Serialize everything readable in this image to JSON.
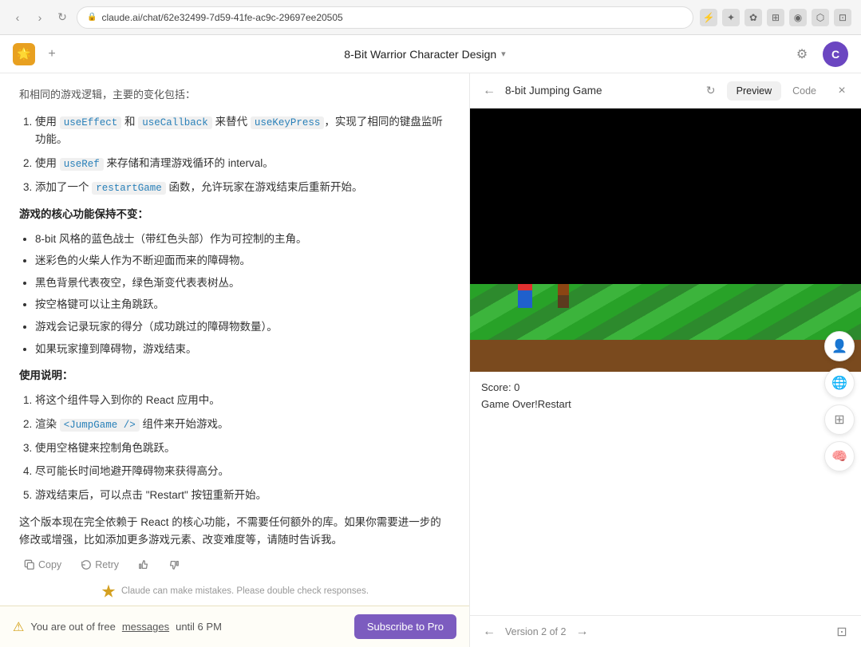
{
  "browser": {
    "url": "claude.ai/chat/62e32499-7d59-41fe-ac9c-29697ee20505",
    "back_disabled": false,
    "forward_disabled": false
  },
  "header": {
    "logo_emoji": "🌟",
    "new_chat_icon": "+",
    "title": "8-Bit Warrior Character Design",
    "chevron": "▾",
    "settings_icon": "⚙",
    "user_initial": "C"
  },
  "chat": {
    "intro_text": "和相同的游戏逻辑，主要的变化包括：",
    "steps": [
      {
        "id": 1,
        "text_parts": [
          "使用 ",
          "useEffect",
          " 和 ",
          "useCallback",
          " 来替代 ",
          "useKeyPress",
          "，实现了相同的键盘监听功能。"
        ]
      },
      {
        "id": 2,
        "text_parts": [
          "使用 ",
          "useRef",
          " 来存储和清理游戏循环的 interval。"
        ]
      },
      {
        "id": 3,
        "text_parts": [
          "添加了一个 ",
          "restartGame",
          " 函数，允许玩家在游戏结束后重新开始。"
        ]
      }
    ],
    "features_title": "游戏的核心功能保持不变：",
    "features": [
      "8-bit 风格的蓝色战士（带红色头部）作为可控制的主角。",
      "迷彩色的火柴人作为不断迎面而来的障碍物。",
      "黑色背景代表夜空，绿色渐变代表表树丛。",
      "按空格键可以让主角跳跃。",
      "游戏会记录玩家的得分（成功跳过的障碍物数量）。",
      "如果玩家撞到障碍物，游戏结束。"
    ],
    "usage_title": "使用说明：",
    "usage_steps": [
      "将这个组件导入到你的 React 应用中。",
      "渲染 <JumpGame /> 组件来开始游戏。",
      "使用空格键来控制角色跳跃。",
      "尽可能长时间地避开障碍物来获得高分。",
      "游戏结束后，可以点击 \"Restart\" 按钮重新开始。"
    ],
    "closing_text": "这个版本现在完全依赖于 React 的核心功能，不需要任何额外的库。如果你需要进一步的修改或增强，比如添加更多游戏元素、改变难度等，请随时告诉我。",
    "actions": {
      "copy": "Copy",
      "retry": "Retry"
    },
    "disclaimer": "Claude can make mistakes. Please double check responses."
  },
  "free_tier": {
    "warning_icon": "⚠",
    "text_before": "You are out of free",
    "link_text": "messages",
    "text_after": "until 6 PM",
    "subscribe_label": "Subscribe to Pro"
  },
  "right_panel": {
    "title": "8-bit Jumping Game",
    "back_icon": "←",
    "refresh_icon": "↻",
    "close_icon": "×",
    "tabs": [
      {
        "label": "Preview",
        "active": true
      },
      {
        "label": "Code",
        "active": false
      }
    ],
    "game": {
      "score_text": "Score: 0",
      "status_text": "Game Over!Restart"
    },
    "bottom_nav": {
      "back_icon": "←",
      "version_text": "Version 2 of 2",
      "forward_icon": "→"
    }
  },
  "floating_buttons": [
    {
      "name": "avatar-float",
      "icon": "👤",
      "color": "#e06060"
    },
    {
      "name": "translate-float",
      "icon": "🌐",
      "color": "#4a90d9"
    },
    {
      "name": "expand-float",
      "icon": "⊞",
      "color": "#888"
    },
    {
      "name": "brain-float",
      "icon": "🧠",
      "color": "#888"
    }
  ]
}
